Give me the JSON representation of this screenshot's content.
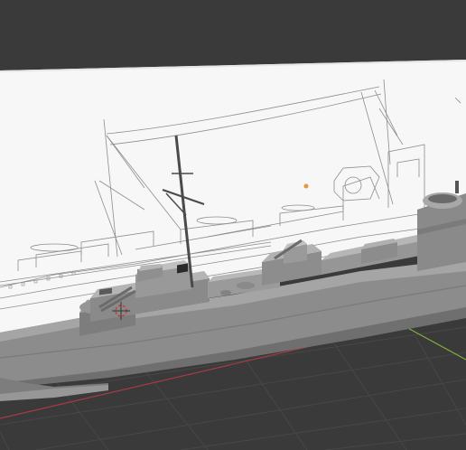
{
  "viewport": {
    "background": "#393939",
    "grid_color": "#464646",
    "x_axis_color": "#a83a45",
    "y_axis_color": "#7fae3b",
    "reference_image_bg": "#f7f7f7",
    "model_color": "#8e8e8e",
    "origin_color": "#e49a3a"
  },
  "objects": [
    {
      "name": "reference-blueprint",
      "kind": "image-plane"
    },
    {
      "name": "ship-hull-model",
      "kind": "mesh"
    },
    {
      "name": "object-origin",
      "kind": "origin-point"
    },
    {
      "name": "3d-cursor",
      "kind": "cursor"
    }
  ]
}
